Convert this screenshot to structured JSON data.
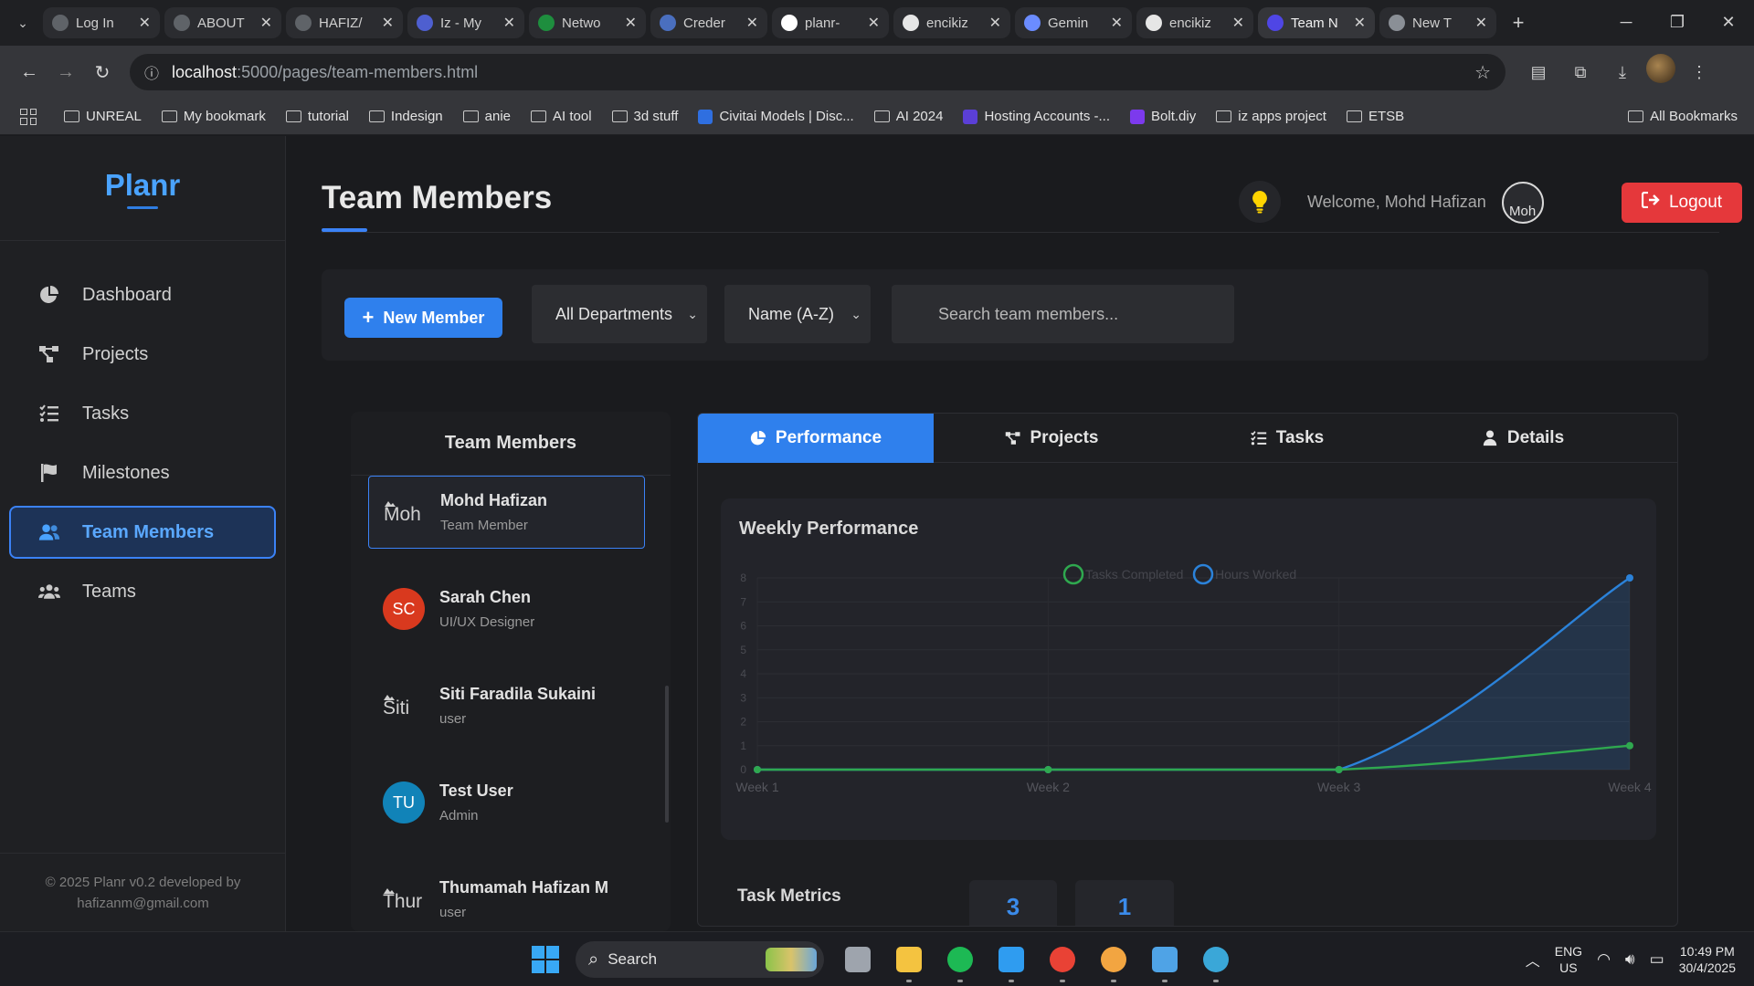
{
  "browser": {
    "tabs": [
      {
        "title": "Log In",
        "icon": "globe-icon",
        "color": "#5f6368"
      },
      {
        "title": "ABOUT",
        "icon": "globe-icon",
        "color": "#5f6368"
      },
      {
        "title": "HAFIZ/",
        "icon": "globe-icon",
        "color": "#5f6368"
      },
      {
        "title": "Iz - My",
        "icon": "list-icon",
        "color": "#4e5fd0"
      },
      {
        "title": "Netwo",
        "icon": "leaf-icon",
        "color": "#1e8e3e"
      },
      {
        "title": "Creder",
        "icon": "api-icon",
        "color": "#4a6fbf"
      },
      {
        "title": "planr-",
        "icon": "vercel-icon",
        "color": "#ffffff"
      },
      {
        "title": "encikiz",
        "icon": "github-icon",
        "color": "#e6e6e6"
      },
      {
        "title": "Gemin",
        "icon": "gemini-icon",
        "color": "#6b8cff"
      },
      {
        "title": "encikiz",
        "icon": "github-icon",
        "color": "#e6e6e6"
      },
      {
        "title": "Team N",
        "icon": "planr-icon",
        "color": "#4f46e5"
      },
      {
        "title": "New T",
        "icon": "chrome-icon",
        "color": "#8a8f96"
      }
    ],
    "active_tab_index": 10,
    "url_host": "localhost",
    "url_path": ":5000/pages/team-members.html",
    "bookmarks": [
      {
        "label": "UNREAL",
        "type": "folder"
      },
      {
        "label": "My bookmark",
        "type": "folder"
      },
      {
        "label": "tutorial",
        "type": "folder"
      },
      {
        "label": "Indesign",
        "type": "folder"
      },
      {
        "label": "anie",
        "type": "folder"
      },
      {
        "label": "AI tool",
        "type": "folder"
      },
      {
        "label": "3d stuff",
        "type": "folder"
      },
      {
        "label": "Civitai Models | Disc...",
        "type": "site",
        "color": "#2f6fe0"
      },
      {
        "label": "AI 2024",
        "type": "folder"
      },
      {
        "label": "Hosting Accounts -...",
        "type": "site",
        "color": "#5b3fd6"
      },
      {
        "label": "Bolt.diy",
        "type": "site",
        "color": "#7c3aed"
      },
      {
        "label": "iz apps project",
        "type": "folder"
      },
      {
        "label": "ETSB",
        "type": "folder"
      }
    ],
    "all_bookmarks": "All Bookmarks"
  },
  "sidebar": {
    "logo": "Planr",
    "items": [
      {
        "label": "Dashboard",
        "icon": "pie-chart-icon",
        "active": false
      },
      {
        "label": "Projects",
        "icon": "project-diagram-icon",
        "active": false
      },
      {
        "label": "Tasks",
        "icon": "tasks-list-icon",
        "active": false
      },
      {
        "label": "Milestones",
        "icon": "flag-icon",
        "active": false
      },
      {
        "label": "Team Members",
        "icon": "users-icon",
        "active": true
      },
      {
        "label": "Teams",
        "icon": "users-group-icon",
        "active": false
      }
    ],
    "footer_line1": "© 2025 Planr v0.2 developed by",
    "footer_line2": "hafizanm@gmail.com"
  },
  "header": {
    "title": "Team Members",
    "welcome": "Welcome, Mohd Hafizan",
    "avatar_alt": "Moh",
    "logout_label": "Logout"
  },
  "filters": {
    "new_member_label": "New Member",
    "department": "All Departments",
    "sort": "Name (A-Z)",
    "search_placeholder": "Search team members..."
  },
  "members": {
    "heading": "Team Members",
    "list": [
      {
        "name": "Mohd Hafizan",
        "role": "Team Member",
        "initials": "Moh",
        "avatar_type": "broken",
        "color": "",
        "selected": true
      },
      {
        "name": "Sarah Chen",
        "role": "UI/UX Designer",
        "initials": "SC",
        "avatar_type": "initials",
        "color": "#d9391e",
        "selected": false
      },
      {
        "name": "Siti Faradila Sukaini",
        "role": "user",
        "initials": "Siti",
        "avatar_type": "broken",
        "color": "",
        "selected": false
      },
      {
        "name": "Test User",
        "role": "Admin",
        "initials": "TU",
        "avatar_type": "initials",
        "color": "#1183b8",
        "selected": false
      },
      {
        "name": "Thumamah Hafizan M",
        "role": "user",
        "initials": "Thur",
        "avatar_type": "broken",
        "color": "",
        "selected": false
      }
    ]
  },
  "detail_tabs": [
    {
      "label": "Performance",
      "icon": "pie-chart-icon",
      "active": true
    },
    {
      "label": "Projects",
      "icon": "project-diagram-icon",
      "active": false
    },
    {
      "label": "Tasks",
      "icon": "tasks-list-icon",
      "active": false
    },
    {
      "label": "Details",
      "icon": "user-icon",
      "active": false
    }
  ],
  "performance": {
    "chart_title": "Weekly Performance",
    "metrics_title": "Task Metrics",
    "metric_values": [
      "3",
      "1"
    ]
  },
  "chart_data": {
    "type": "line",
    "title": "Weekly Performance",
    "categories": [
      "Week 1",
      "Week 2",
      "Week 3",
      "Week 4"
    ],
    "series": [
      {
        "name": "Tasks Completed",
        "values": [
          0,
          0,
          0,
          1
        ],
        "color": "#2fa84f",
        "fill": false
      },
      {
        "name": "Hours Worked",
        "values": [
          0,
          0,
          0,
          8
        ],
        "color": "#2b82d9",
        "fill": true
      }
    ],
    "ylim": [
      0,
      8
    ],
    "y_ticks": [
      0,
      1,
      2,
      3,
      4,
      5,
      6,
      7,
      8
    ],
    "legend": "top-center",
    "grid": true
  },
  "taskbar": {
    "search_label": "Search",
    "apps": [
      "files-icon",
      "folder-icon",
      "spotify-icon",
      "vscode-icon",
      "chrome-icon",
      "chrome-canary-icon",
      "notepad-icon",
      "globe-icon"
    ],
    "lang_line1": "ENG",
    "lang_line2": "US",
    "time": "10:49 PM",
    "date": "30/4/2025"
  }
}
